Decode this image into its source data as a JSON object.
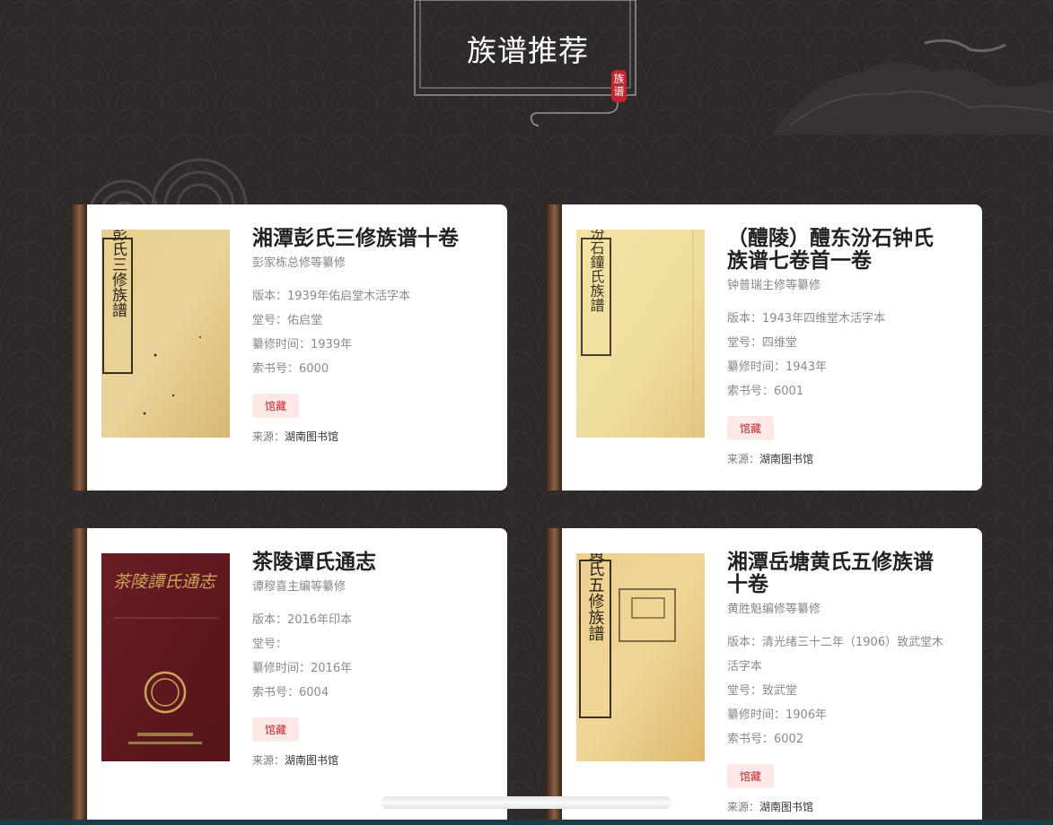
{
  "section": {
    "title": "族谱推荐",
    "seal_text": "族谱"
  },
  "labels": {
    "edition": "版本：",
    "hall": "堂号：",
    "compiled": "纂修时间：",
    "call_number": "索书号：",
    "source": "来源："
  },
  "books": [
    {
      "title": "湘潭彭氏三修族谱十卷",
      "author": "彭家栋总修等纂修",
      "edition": "1939年佑启堂木活字本",
      "hall": "佑启堂",
      "compiled": "1939年",
      "call_number": "6000",
      "badge": "馆藏",
      "source": "湖南图书馆",
      "cover_text": "湘潭彭氏三修族譜"
    },
    {
      "title": "（醴陵）醴东汾石钟氏族谱七卷首一卷",
      "author": "钟普瑞主修等纂修",
      "edition": "1943年四维堂木活字本",
      "hall": "四维堂",
      "compiled": "1943年",
      "call_number": "6001",
      "badge": "馆藏",
      "source": "湖南图书馆",
      "cover_text": "醴東汾石鐘氏族譜"
    },
    {
      "title": "茶陵谭氏通志",
      "author": "谭穆喜主编等纂修",
      "edition": "2016年印本",
      "hall": "",
      "compiled": "2016年",
      "call_number": "6004",
      "badge": "馆藏",
      "source": "湖南图书馆",
      "cover_text": "茶陵譚氏通志"
    },
    {
      "title": "湘潭岳塘黄氏五修族谱十卷",
      "author": "黄胜魁编修等纂修",
      "edition": "清光绪三十二年（1906）致武堂木活字本",
      "hall": "致武堂",
      "compiled": "1906年",
      "call_number": "6002",
      "badge": "馆藏",
      "source": "湖南图书馆",
      "cover_text": "嶽塘黃氏五修族譜"
    }
  ]
}
